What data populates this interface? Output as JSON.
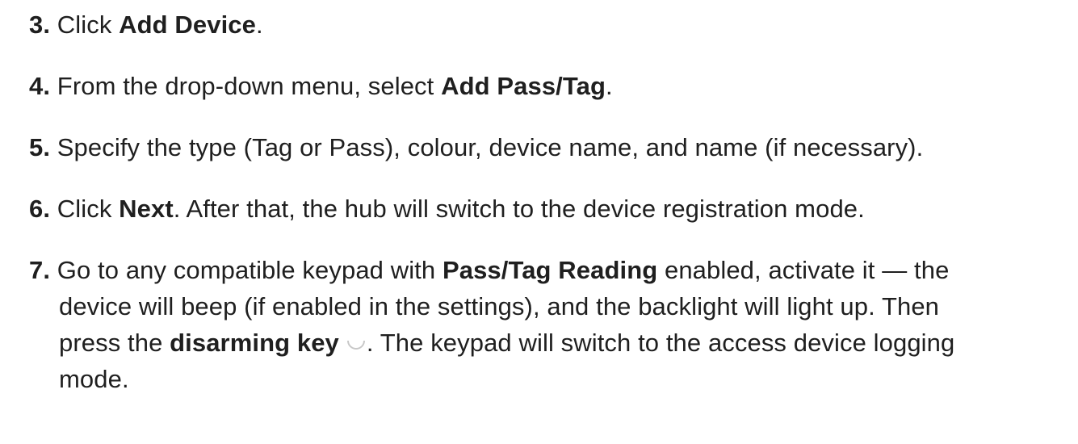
{
  "steps": [
    {
      "number": "3.",
      "parts": [
        "Click ",
        "Add Device",
        "."
      ]
    },
    {
      "number": "4.",
      "parts": [
        "From the drop-down menu, select ",
        "Add Pass/Tag",
        "."
      ]
    },
    {
      "number": "5.",
      "parts": [
        "Specify the type (Tag or Pass), colour, device name, and name (if necessary)."
      ]
    },
    {
      "number": "6.",
      "parts": [
        "Click ",
        "Next",
        ". After that, the hub will switch to the device registration mode."
      ]
    },
    {
      "number": "7.",
      "lines": [
        {
          "pre": "Go to any compatible keypad with ",
          "bold": "Pass/Tag Reading",
          "post": " enabled, activate it — the"
        },
        {
          "text": "device will beep (if enabled in the settings), and the backlight will light up. Then"
        },
        {
          "pre": "press the ",
          "bold": "disarming key",
          "post": ". The keypad will switch to the access device logging"
        },
        {
          "text": "mode."
        }
      ],
      "icon": "disarm-circle-icon"
    }
  ]
}
